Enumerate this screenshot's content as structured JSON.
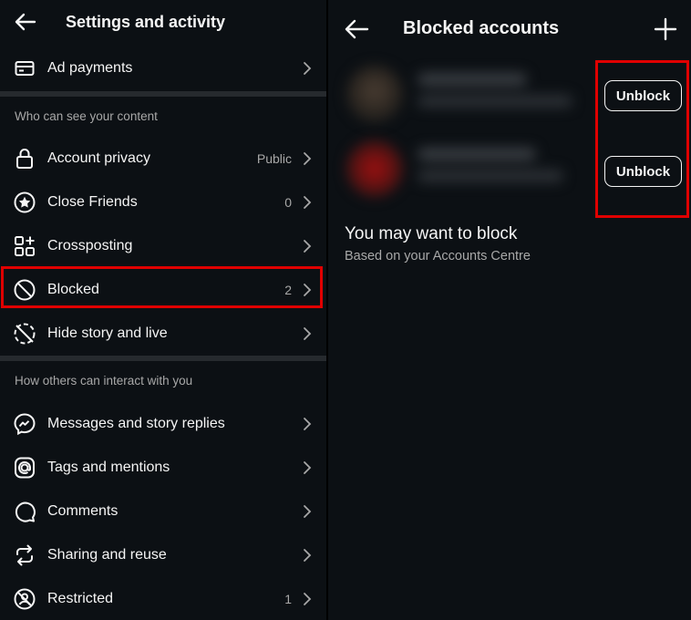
{
  "left_panel": {
    "title": "Settings and activity",
    "top_item": {
      "label": "Ad payments",
      "icon": "card-icon"
    },
    "section1_title": "Who can see your content",
    "section1_items": [
      {
        "label": "Account privacy",
        "value": "Public",
        "icon": "lock-icon"
      },
      {
        "label": "Close Friends",
        "value": "0",
        "icon": "star-circle-icon"
      },
      {
        "label": "Crossposting",
        "value": "",
        "icon": "grid-plus-icon"
      },
      {
        "label": "Blocked",
        "value": "2",
        "icon": "blocked-icon"
      },
      {
        "label": "Hide story and live",
        "value": "",
        "icon": "hide-story-icon"
      }
    ],
    "section2_title": "How others can interact with you",
    "section2_items": [
      {
        "label": "Messages and story replies",
        "value": "",
        "icon": "messenger-icon"
      },
      {
        "label": "Tags and mentions",
        "value": "",
        "icon": "at-sign-icon"
      },
      {
        "label": "Comments",
        "value": "",
        "icon": "comment-icon"
      },
      {
        "label": "Sharing and reuse",
        "value": "",
        "icon": "share-loop-icon"
      },
      {
        "label": "Restricted",
        "value": "1",
        "icon": "restricted-icon"
      }
    ]
  },
  "right_panel": {
    "title": "Blocked accounts",
    "unblock_label": "Unblock",
    "suggest_title": "You may want to block",
    "suggest_subtitle": "Based on your Accounts Centre"
  },
  "colors": {
    "background": "#0c1014",
    "text": "#f5f5f5",
    "secondary_text": "#a8a8a8",
    "highlight": "#e00000"
  }
}
